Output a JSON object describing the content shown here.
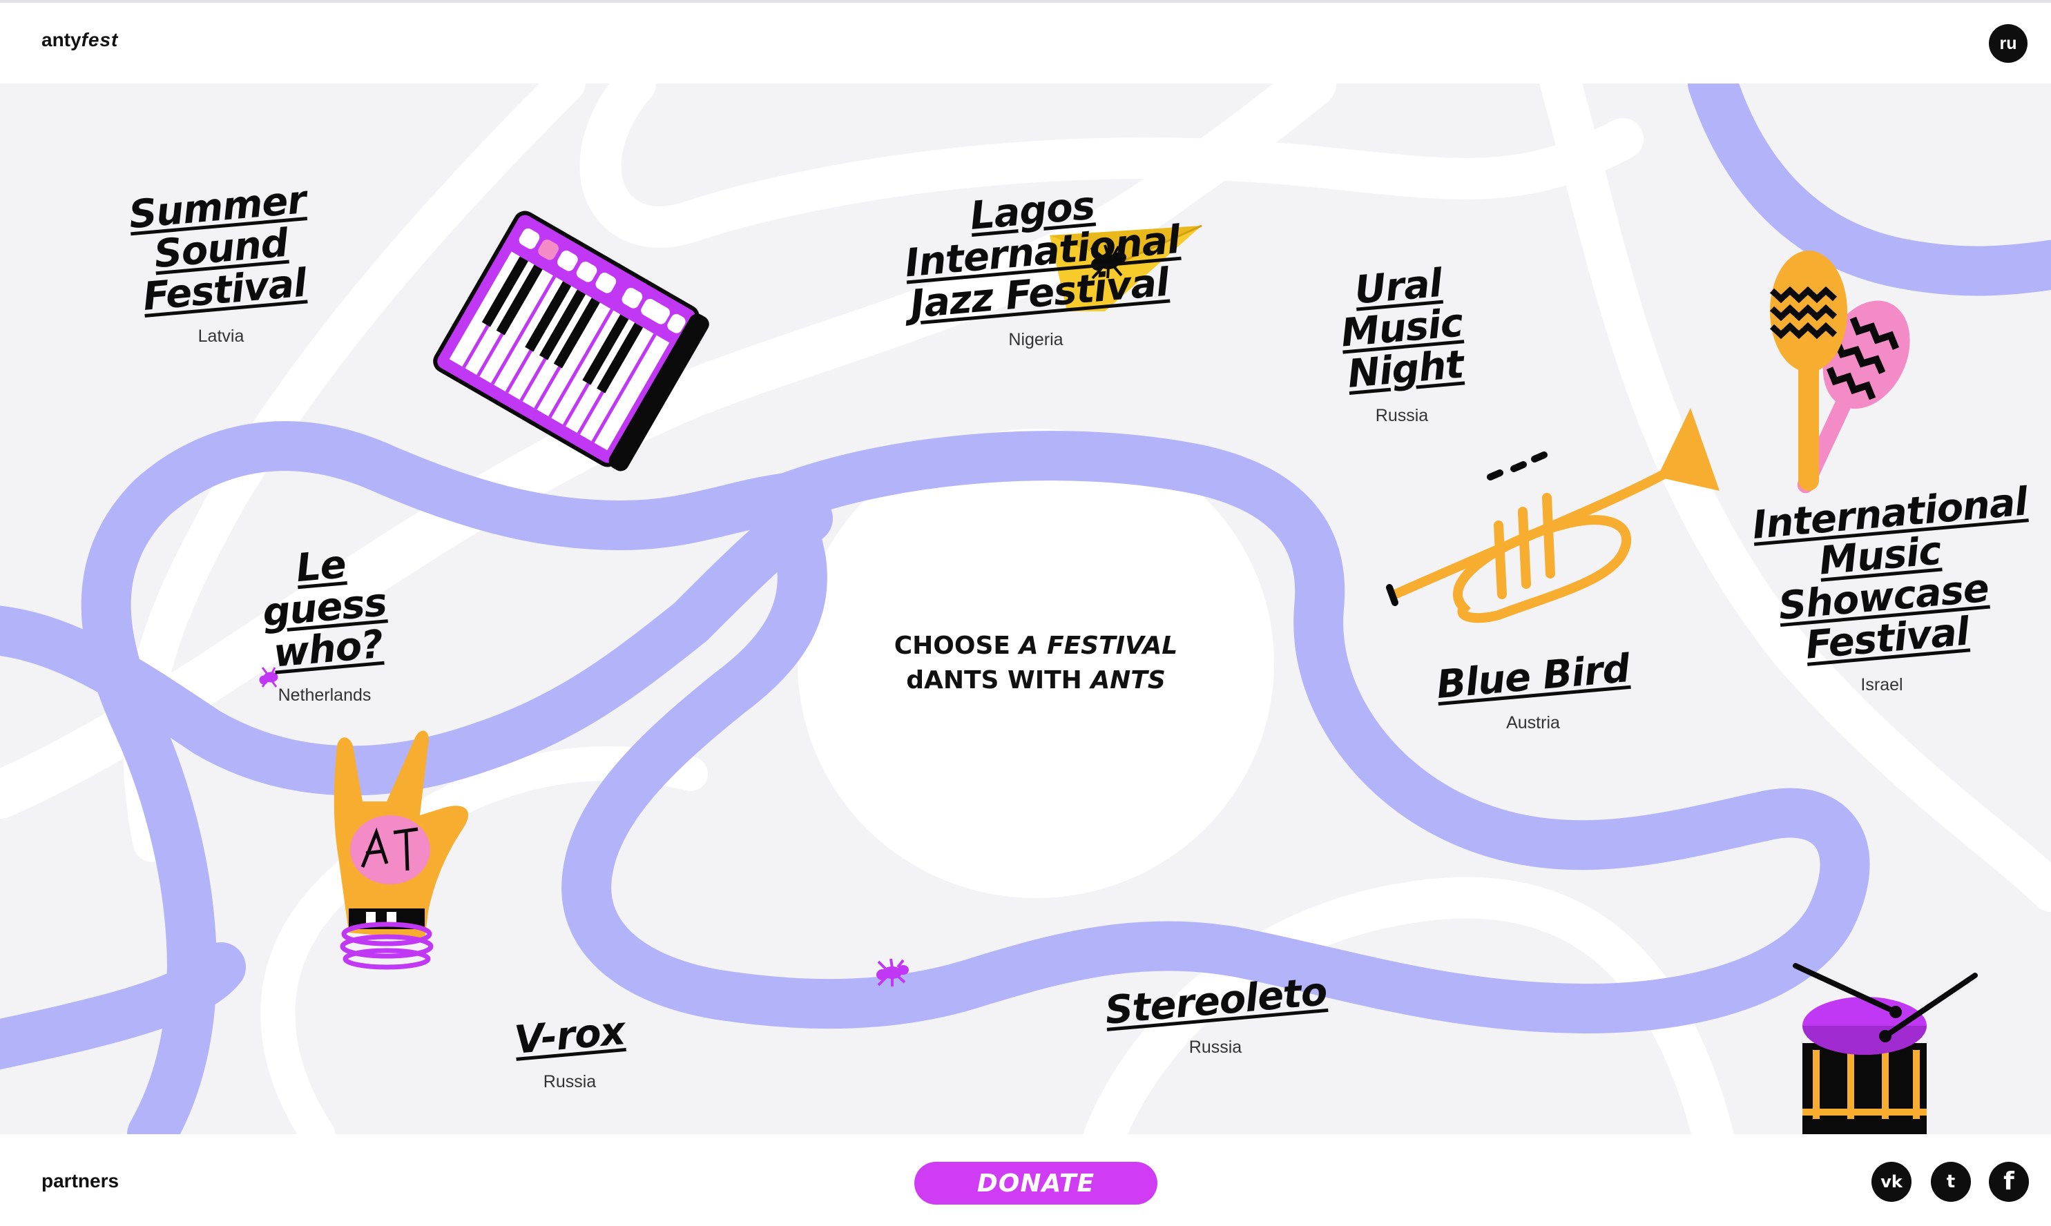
{
  "header": {
    "logo_plain": "anty",
    "logo_italic": "fest",
    "lang_button": "ru"
  },
  "center": {
    "line1_plain": "CHOOSE ",
    "line1_italic": "A FESTIVAL",
    "line2_plain": "dANTS WITH ",
    "line2_italic": "ANTS"
  },
  "festivals": [
    {
      "name": "Summer Sound Festival",
      "country": "Latvia"
    },
    {
      "name": "Lagos International Jazz Festival",
      "country": "Nigeria"
    },
    {
      "name": "Ural Music Night",
      "country": "Russia"
    },
    {
      "name": "International Music Showcase Festival",
      "country": "Israel"
    },
    {
      "name": "Le guess who?",
      "country": "Netherlands"
    },
    {
      "name": "Blue Bird",
      "country": "Austria"
    },
    {
      "name": "V-rox",
      "country": "Russia"
    },
    {
      "name": "Stereoleto",
      "country": "Russia"
    }
  ],
  "footer": {
    "partners_label": "partners",
    "donate_label": "DONATE",
    "social": {
      "vk": "vk",
      "twitter": "t",
      "facebook": "f"
    }
  },
  "colors": {
    "path": "#b3b3f9",
    "accent": "#cf3cf4",
    "yellow": "#f7ad2f",
    "pink": "#f38bc6",
    "map_bg": "#f3f3f5"
  },
  "icons": [
    "keyboard-icon",
    "paper-plane-icon",
    "maracas-icon",
    "trumpet-icon",
    "rock-hand-icon",
    "drum-icon",
    "ant-icon"
  ]
}
